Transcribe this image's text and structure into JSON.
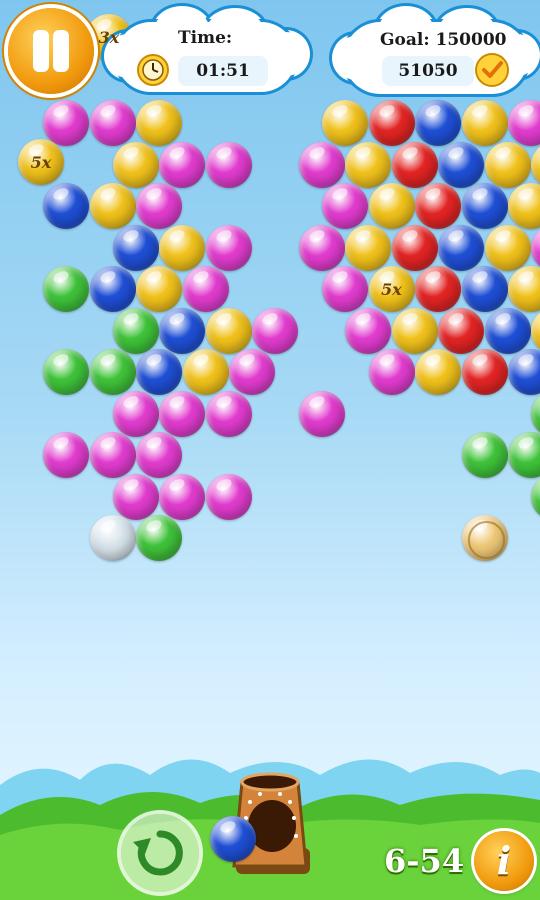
{
  "hud": {
    "time_label": "Time:",
    "time_value": "01:51",
    "goal_label": "Goal: 150000",
    "score_value": "51050"
  },
  "footer": {
    "level_label": "6-54",
    "info_glyph": "i"
  },
  "icons": {
    "pause": "pause-icon",
    "clock": "clock-icon",
    "check": "check-icon",
    "restart": "restart-icon",
    "info": "info-icon"
  },
  "colors": {
    "red": "#e32424",
    "green": "#3fc33a",
    "blue": "#1f4fd6",
    "yellow": "#f1c21b",
    "magenta": "#e23ccf",
    "silver": "#d8e4ec",
    "coin": "#efc878",
    "orange_button": "#f19a0d"
  },
  "board": {
    "legend": {
      "R": "red",
      "G": "green",
      "B": "blue",
      "Y": "yellow",
      "M": "magenta",
      "S": "silver",
      "C": "coin",
      "x": "yellow"
    },
    "rows": [
      "..MMY...YRBYMM...",
      "...YMM.MYRBYYMM..",
      "..BYM...MYRBYM...",
      "...BYM.MYRBYM....",
      "..GBYM..MxRBY....",
      "...GBYM.MYRBY....",
      "..GGBYM..MYRB....",
      "...MMM.M....GGG..",
      "..MMM......GGG...",
      "...MMM......GGG..",
      "...SG......C....."
    ],
    "multipliers": [
      {
        "label": "5x"
      },
      {
        "label": "5x"
      },
      {
        "label": "3x"
      }
    ],
    "shooter_ball": "blue"
  }
}
